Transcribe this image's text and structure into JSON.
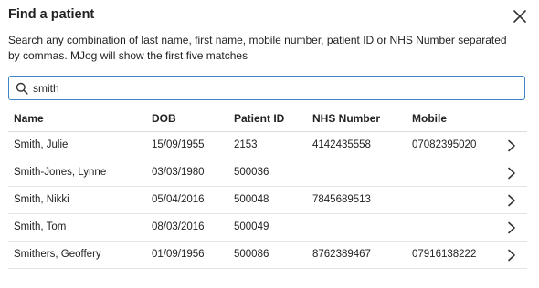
{
  "dialog": {
    "title": "Find a patient",
    "description": "Search any combination of last name, first name, mobile number, patient ID or NHS Number separated by commas. MJog will show the first five matches"
  },
  "search": {
    "value": "smith",
    "icon": "search-icon"
  },
  "table": {
    "columns": [
      "Name",
      "DOB",
      "Patient ID",
      "NHS Number",
      "Mobile"
    ],
    "rows": [
      {
        "name": "Smith, Julie",
        "dob": "15/09/1955",
        "pid": "2153",
        "nhs": "4142435558",
        "mobile": "07082395020"
      },
      {
        "name": "Smith-Jones, Lynne",
        "dob": "03/03/1980",
        "pid": "500036",
        "nhs": "",
        "mobile": ""
      },
      {
        "name": "Smith, Nikki",
        "dob": "05/04/2016",
        "pid": "500048",
        "nhs": "7845689513",
        "mobile": ""
      },
      {
        "name": "Smith, Tom",
        "dob": "08/03/2016",
        "pid": "500049",
        "nhs": "",
        "mobile": ""
      },
      {
        "name": "Smithers, Geoffery",
        "dob": "01/09/1956",
        "pid": "500086",
        "nhs": "8762389467",
        "mobile": "07916138222"
      }
    ]
  },
  "colors": {
    "search_border": "#3b82c8",
    "divider": "#e4e4e4",
    "text": "#222222"
  }
}
